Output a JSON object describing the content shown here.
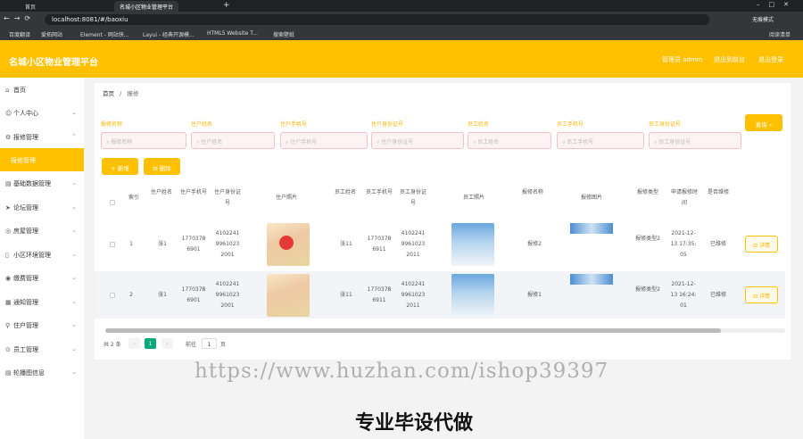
{
  "browser": {
    "tabs": [
      "首页",
      "名城小区物业管理平台"
    ],
    "url": "localhost:8081/#/baoxiu",
    "profile": "无痕模式",
    "bookmarks": [
      "百度翻译",
      "爱拓网站",
      "Element - 网站快...",
      "Layui - 经典开源模...",
      "HTML5 Website T...",
      "搜索壁纸"
    ],
    "reading_list": "阅读清单"
  },
  "header": {
    "title": "名城小区物业管理平台",
    "admin": "管理员 admin",
    "back": "退出到前台",
    "logout": "退出登录"
  },
  "sidebar": {
    "items": [
      {
        "label": "首页",
        "icon": "home-icon"
      },
      {
        "label": "个人中心",
        "icon": "user-icon"
      },
      {
        "label": "报修管理",
        "icon": "tool-icon"
      },
      {
        "label": "报修管理",
        "icon": ""
      },
      {
        "label": "基础数据管理",
        "icon": "data-icon"
      },
      {
        "label": "论坛管理",
        "icon": "forum-icon"
      },
      {
        "label": "房屋管理",
        "icon": "house-icon"
      },
      {
        "label": "小区环境管理",
        "icon": "env-icon"
      },
      {
        "label": "缴费管理",
        "icon": "pay-icon"
      },
      {
        "label": "通知管理",
        "icon": "notice-icon"
      },
      {
        "label": "住户管理",
        "icon": "resident-icon"
      },
      {
        "label": "员工管理",
        "icon": "staff-icon"
      },
      {
        "label": "轮播图信息",
        "icon": "banner-icon"
      }
    ]
  },
  "breadcrumb": {
    "home": "首页",
    "sep": "/",
    "current": "报修"
  },
  "filters": [
    {
      "label": "报修名称",
      "placeholder": "报修名称"
    },
    {
      "label": "住户姓名",
      "placeholder": "住户姓名"
    },
    {
      "label": "住户手机号",
      "placeholder": "住户手机号"
    },
    {
      "label": "住户身份证号",
      "placeholder": "住户身份证号"
    },
    {
      "label": "员工姓名",
      "placeholder": "员工姓名"
    },
    {
      "label": "员工手机号",
      "placeholder": "员工手机号"
    },
    {
      "label": "员工身份证号",
      "placeholder": "员工身份证号"
    }
  ],
  "buttons": {
    "search": "查询",
    "add": "+ 新增",
    "delete": "删除",
    "detail": "详情"
  },
  "table": {
    "headers": [
      "索引",
      "住户姓名",
      "住户手机号",
      "住户身份证号",
      "住户照片",
      "员工姓名",
      "员工手机号",
      "员工身份证号",
      "员工照片",
      "报修名称",
      "报修图片",
      "报修类型",
      "申请报修时间",
      "是否维修"
    ],
    "rows": [
      {
        "index": "1",
        "resident": "张1",
        "phone": "17703786901",
        "idno": "410224199610232001",
        "staff": "张11",
        "staff_phone": "17703786911",
        "staff_id": "410224199610232011",
        "name": "报修2",
        "type": "报修类型2",
        "time": "2021-12-13 17:35:05",
        "status": "已维修"
      },
      {
        "index": "2",
        "resident": "张1",
        "phone": "17703786901",
        "idno": "410224199610232001",
        "staff": "张11",
        "staff_phone": "17703786911",
        "staff_id": "410224199610232011",
        "name": "报修1",
        "type": "报修类型2",
        "time": "2021-12-13 16:24:01",
        "status": "已维修"
      }
    ]
  },
  "pagination": {
    "total": "共 2 条",
    "current": "1",
    "goto": "前往",
    "page_input": "1",
    "page_unit": "页"
  },
  "overlay": {
    "watermark": "https://www.huzhan.com/ishop39397",
    "caption": "专业毕设代做"
  }
}
